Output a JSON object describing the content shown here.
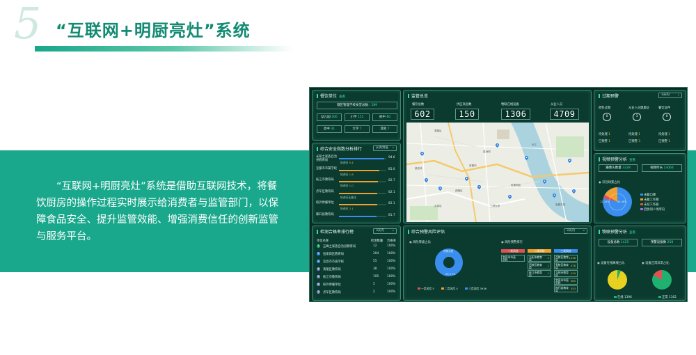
{
  "slide": {
    "number": "5",
    "title": "“互联网+明厨亮灶”系统",
    "description": "“互联网+明厨亮灶”系统是借助互联网技术，将餐饮厨房的操作过程实时展示给消费者与监管部门，以保障食品安全、提升监管效能、增强消费信任的创新监管与服务平台。"
  },
  "dashboard": {
    "catering": {
      "title": "餐饮单位",
      "sub": "查看",
      "total_label": "辖区管理学校食堂总数：",
      "total_value": "589",
      "items": [
        {
          "label": "幼儿园",
          "value": "306"
        },
        {
          "label": "小学",
          "value": "151"
        },
        {
          "label": "初中",
          "value": "80"
        },
        {
          "label": "高中",
          "value": "31"
        },
        {
          "label": "大学",
          "value": "7"
        },
        {
          "label": "其他",
          "value": "7"
        }
      ]
    },
    "safety_rank": {
      "title": "综合安全指数分析排行",
      "select": "从高到低",
      "rows": [
        {
          "name": "长阳土家族自治县教育局",
          "score": "94.6",
          "fraction": 0.95,
          "detail_label": "轮询日",
          "detail_value": "5.4"
        },
        {
          "name": "宜都市市属学校",
          "score": "85.0",
          "fraction": 0.85,
          "detail_label": "轮询日",
          "detail_value": "1.6"
        },
        {
          "name": "枝江市教育局",
          "score": "82.7",
          "fraction": 0.82,
          "detail_label": "轮询日",
          "detail_value": "1.0"
        },
        {
          "name": "点军区教育局",
          "score": "82.1",
          "fraction": 0.81,
          "detail_label": "轮询日无变化",
          "detail_value": ""
        },
        {
          "name": "校外供餐单位",
          "score": "82.1",
          "fraction": 0.81,
          "detail_label": "轮询日",
          "detail_value": "2.1"
        },
        {
          "name": "秭归县教育局",
          "score": "81.7",
          "fraction": 0.8,
          "detail_label": "",
          "detail_value": ""
        }
      ]
    },
    "pass_rank": {
      "title": "检测合格率排行榜",
      "select": "3天内",
      "headers": [
        "单位名称",
        "检测数量",
        "合格率"
      ],
      "rows": [
        {
          "rank": "1",
          "name": "五峰土家族自治县教育局",
          "count": "12",
          "rate": "100%"
        },
        {
          "rank": "2",
          "name": "伍家岗区教育局",
          "count": "204",
          "rate": "100%"
        },
        {
          "rank": "3",
          "name": "宜昌市市直学校",
          "count": "55",
          "rate": "100%"
        },
        {
          "rank": "4",
          "name": "夷陵区教育局",
          "count": "38",
          "rate": "100%"
        },
        {
          "rank": "5",
          "name": "枝江市教育局",
          "count": "195",
          "rate": "100%"
        },
        {
          "rank": "6",
          "name": "校外供餐单位",
          "count": "5",
          "rate": "100%"
        },
        {
          "rank": "7",
          "name": "点军区教育局",
          "count": "2",
          "rate": "100%"
        }
      ]
    },
    "monitor": {
      "title": "监管总览",
      "stats": [
        {
          "label": "餐饮总数",
          "value": "602"
        },
        {
          "label": "供应商总数",
          "value": "150"
        },
        {
          "label": "物联在线设备",
          "value": "1306"
        },
        {
          "label": "从业人员",
          "value": "4709"
        }
      ],
      "map_labels": [
        "宜昌市",
        "夷陵区",
        "西陵区",
        "伍家岗区",
        "点军区",
        "三峡大学",
        "长江",
        "宜昌东站",
        "桃花岭",
        "葛洲坝"
      ]
    },
    "risk": {
      "title": "综合预警风险评估",
      "select": "3天内",
      "left_label": "风险等级占比",
      "right_label": "风险预警排行",
      "donut_center": "预警总数",
      "donut_value": "95.77%",
      "legend": [
        {
          "label": "一类风险 5",
          "color": "#e25050"
        },
        {
          "label": "二类风险 4",
          "color": "#f0a030"
        },
        {
          "label": "三类风险 3936",
          "color": "#3a8ef0"
        }
      ],
      "columns": [
        {
          "header": "一类风险",
          "color": "#e25050",
          "items": [
            {
              "name": "宜昌市市直学校",
              "count": ""
            }
          ]
        },
        {
          "header": "二类风险",
          "color": "#f0a030",
          "items": [
            {
              "name": "当阳市教育局",
              "count": "2"
            },
            {
              "name": "西陵区教育局",
              "count": "1"
            },
            {
              "name": "枝江市教育局",
              "count": "1"
            }
          ]
        },
        {
          "header": "三类风险",
          "color": "#3a8ef0",
          "items": [
            {
              "name": "西陵区教育局",
              "count": "1238"
            },
            {
              "name": "夷陵区教育局",
              "count": "478"
            },
            {
              "name": "当阳市教育局",
              "count": "419"
            },
            {
              "name": "宜昌市市直学校",
              "count": "385"
            },
            {
              "name": "秭归县教育局",
              "count": "353"
            }
          ]
        }
      ]
    },
    "expired": {
      "title": "过期预警",
      "select": "3天内",
      "items": [
        {
          "label": "原料过期",
          "value": "0"
        },
        {
          "label": "从业人员健康证",
          "value": "3"
        },
        {
          "label": "餐饮证件",
          "value": "0"
        }
      ],
      "subs": [
        {
          "label": "待处理",
          "value": "1"
        },
        {
          "label": "已预警",
          "value": "1"
        },
        {
          "label": "待处理",
          "value": "1"
        },
        {
          "label": "已预警",
          "value": "3"
        },
        {
          "label": "待处理",
          "value": "1"
        },
        {
          "label": "已预警",
          "value": "1"
        }
      ]
    },
    "video": {
      "title": "视频预警分析",
      "sub": "查看",
      "stat1_label": "摄像头数量",
      "stat1_value": "3228",
      "stat2_label": "视频时长",
      "stat2_value": "23064",
      "pie_label": "识别场景占比",
      "pie_values": [
        "12.23%",
        "84.46%"
      ],
      "legend": [
        {
          "label": "未戴口罩",
          "color": "#3a8ef0"
        },
        {
          "label": "未戴工作帽",
          "color": "#f0a030"
        },
        {
          "label": "未穿工作服",
          "color": "#e25050"
        },
        {
          "label": "后厨闲人场所内",
          "color": "#a070e0"
        }
      ]
    },
    "iot": {
      "title": "物联预警分析",
      "sub": "查看",
      "stat1_label": "设备总数",
      "stat1_value": "1425",
      "stat2_label": "预警设备数",
      "stat2_value": "258",
      "pie1_label": "设备在线离线占比",
      "pie2_label": "设备正常异常占比",
      "pie1_legend": "在线 1396",
      "pie2_legend": "正常 1162"
    }
  }
}
